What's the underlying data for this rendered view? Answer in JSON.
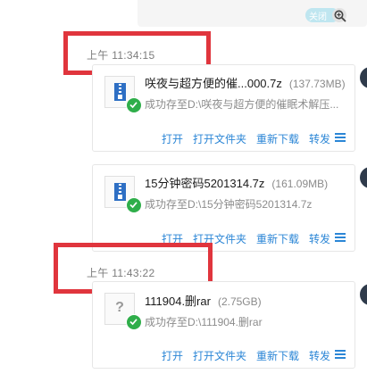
{
  "toggle": {
    "label": "关闭"
  },
  "timestamps": [
    "上午 11:34:15",
    "上午 11:43:22"
  ],
  "files": [
    {
      "name": "咲夜与超方便的催...000.7z",
      "size": "(137.73MB)",
      "status": "成功存至D:\\咲夜与超方便的催眠术解压...",
      "icon": "zip-file-icon"
    },
    {
      "name": "15分钟密码5201314.7z",
      "size": "(161.09MB)",
      "status": "成功存至D:\\15分钟密码5201314.7z",
      "icon": "zip-file-icon"
    },
    {
      "name": "111904.删rar",
      "size": "(2.75GB)",
      "status": "成功存至D:\\111904.删rar",
      "icon": "unknown-file-icon"
    }
  ],
  "actions": {
    "open": "打开",
    "open_folder": "打开文件夹",
    "redownload": "重新下载",
    "forward": "转发"
  },
  "colors": {
    "link": "#2b86d6",
    "success": "#2fae4a",
    "annotation": "#e0353d",
    "timestamp": "#7c7c7c"
  }
}
